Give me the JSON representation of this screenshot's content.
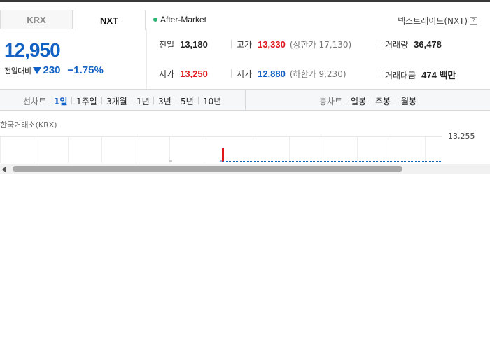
{
  "tabs": [
    {
      "label": "KRX",
      "active": false
    },
    {
      "label": "NXT",
      "active": true
    }
  ],
  "session": {
    "label": "After-Market",
    "dot_color": "#2bb673"
  },
  "exchange_link": {
    "label": "넥스트레이드(NXT)",
    "help_icon": "?"
  },
  "price": {
    "current": "12,950",
    "change_label": "전일대비",
    "change_value": "230",
    "change_direction": "down",
    "change_percent": "−1.75%"
  },
  "stats": {
    "prev_close": {
      "label": "전일",
      "value": "13,180"
    },
    "high": {
      "label": "고가",
      "value": "13,330",
      "sub": "(상한가 17,130)"
    },
    "volume": {
      "label": "거래량",
      "value": "36,478"
    },
    "open": {
      "label": "시가",
      "value": "13,250"
    },
    "low": {
      "label": "저가",
      "value": "12,880",
      "sub": "(하한가 9,230)"
    },
    "trade_value": {
      "label": "거래대금",
      "value": "474 백만"
    }
  },
  "line_chart": {
    "label": "선차트",
    "periods": [
      "1일",
      "1주일",
      "3개월",
      "1년",
      "3년",
      "5년",
      "10년"
    ],
    "selected": "1일"
  },
  "candle_chart": {
    "label": "봉차트",
    "periods": [
      "일봉",
      "주봉",
      "월봉"
    ]
  },
  "chart": {
    "source": "한국거래소(KRX)",
    "y_tick": "13,255"
  },
  "colors": {
    "up": "#e0181e",
    "down": "#1261c4",
    "accent": "#1261c4"
  }
}
